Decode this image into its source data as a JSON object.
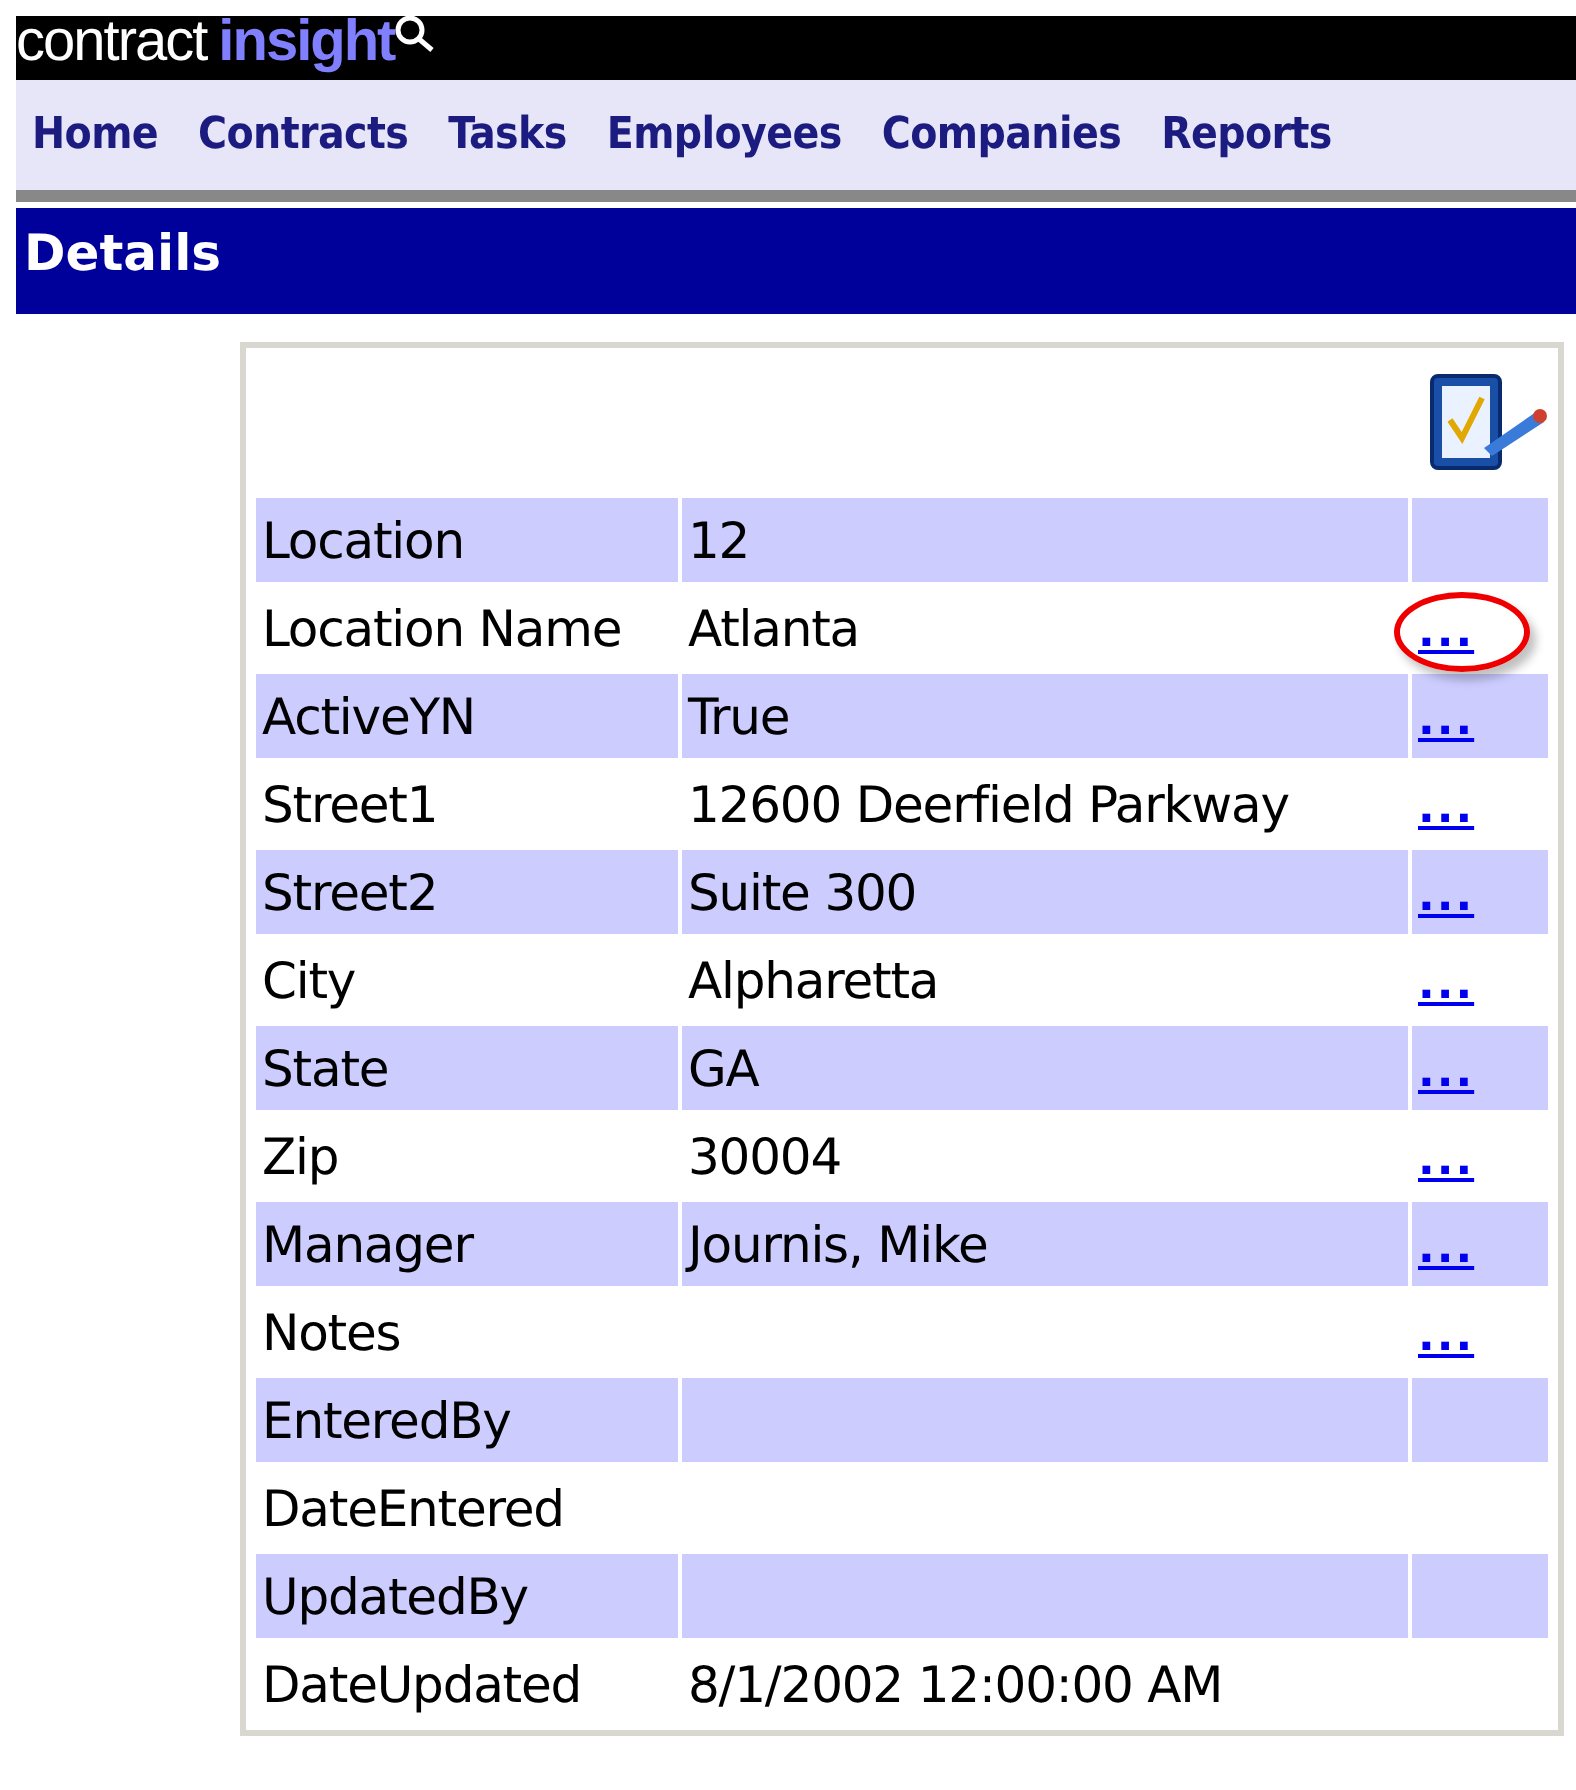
{
  "header": {
    "brand_light": "contract",
    "brand_bold": "insight"
  },
  "nav": {
    "items": [
      "Home",
      "Contracts",
      "Tasks",
      "Employees",
      "Companies",
      "Reports"
    ]
  },
  "section": {
    "title": "Details"
  },
  "details": {
    "rows": [
      {
        "label": "Location",
        "value": "12"
      },
      {
        "label": "Location Name",
        "value": "Atlanta",
        "link": "...",
        "highlighted": true
      },
      {
        "label": "ActiveYN",
        "value": "True",
        "link": "...",
        "highlighted": false
      },
      {
        "label": "Street1",
        "value": "12600 Deerfield Parkway",
        "link": "...",
        "highlighted": false
      },
      {
        "label": "Street2",
        "value": "Suite 300",
        "link": "...",
        "highlighted": false
      },
      {
        "label": "City",
        "value": "Alpharetta",
        "link": "...",
        "highlighted": false
      },
      {
        "label": "State",
        "value": "GA",
        "link": "...",
        "highlighted": false
      },
      {
        "label": "Zip",
        "value": "30004",
        "link": "...",
        "highlighted": false
      },
      {
        "label": "Manager",
        "value": "Journis, Mike",
        "link": "...",
        "highlighted": false
      },
      {
        "label": "Notes",
        "link": "...",
        "highlighted": false
      },
      {
        "label": "EnteredBy"
      },
      {
        "label": "DateEntered"
      },
      {
        "label": "UpdatedBy"
      },
      {
        "label": "DateUpdated",
        "value": "8/1/2002 12:00:00 AM"
      }
    ]
  }
}
